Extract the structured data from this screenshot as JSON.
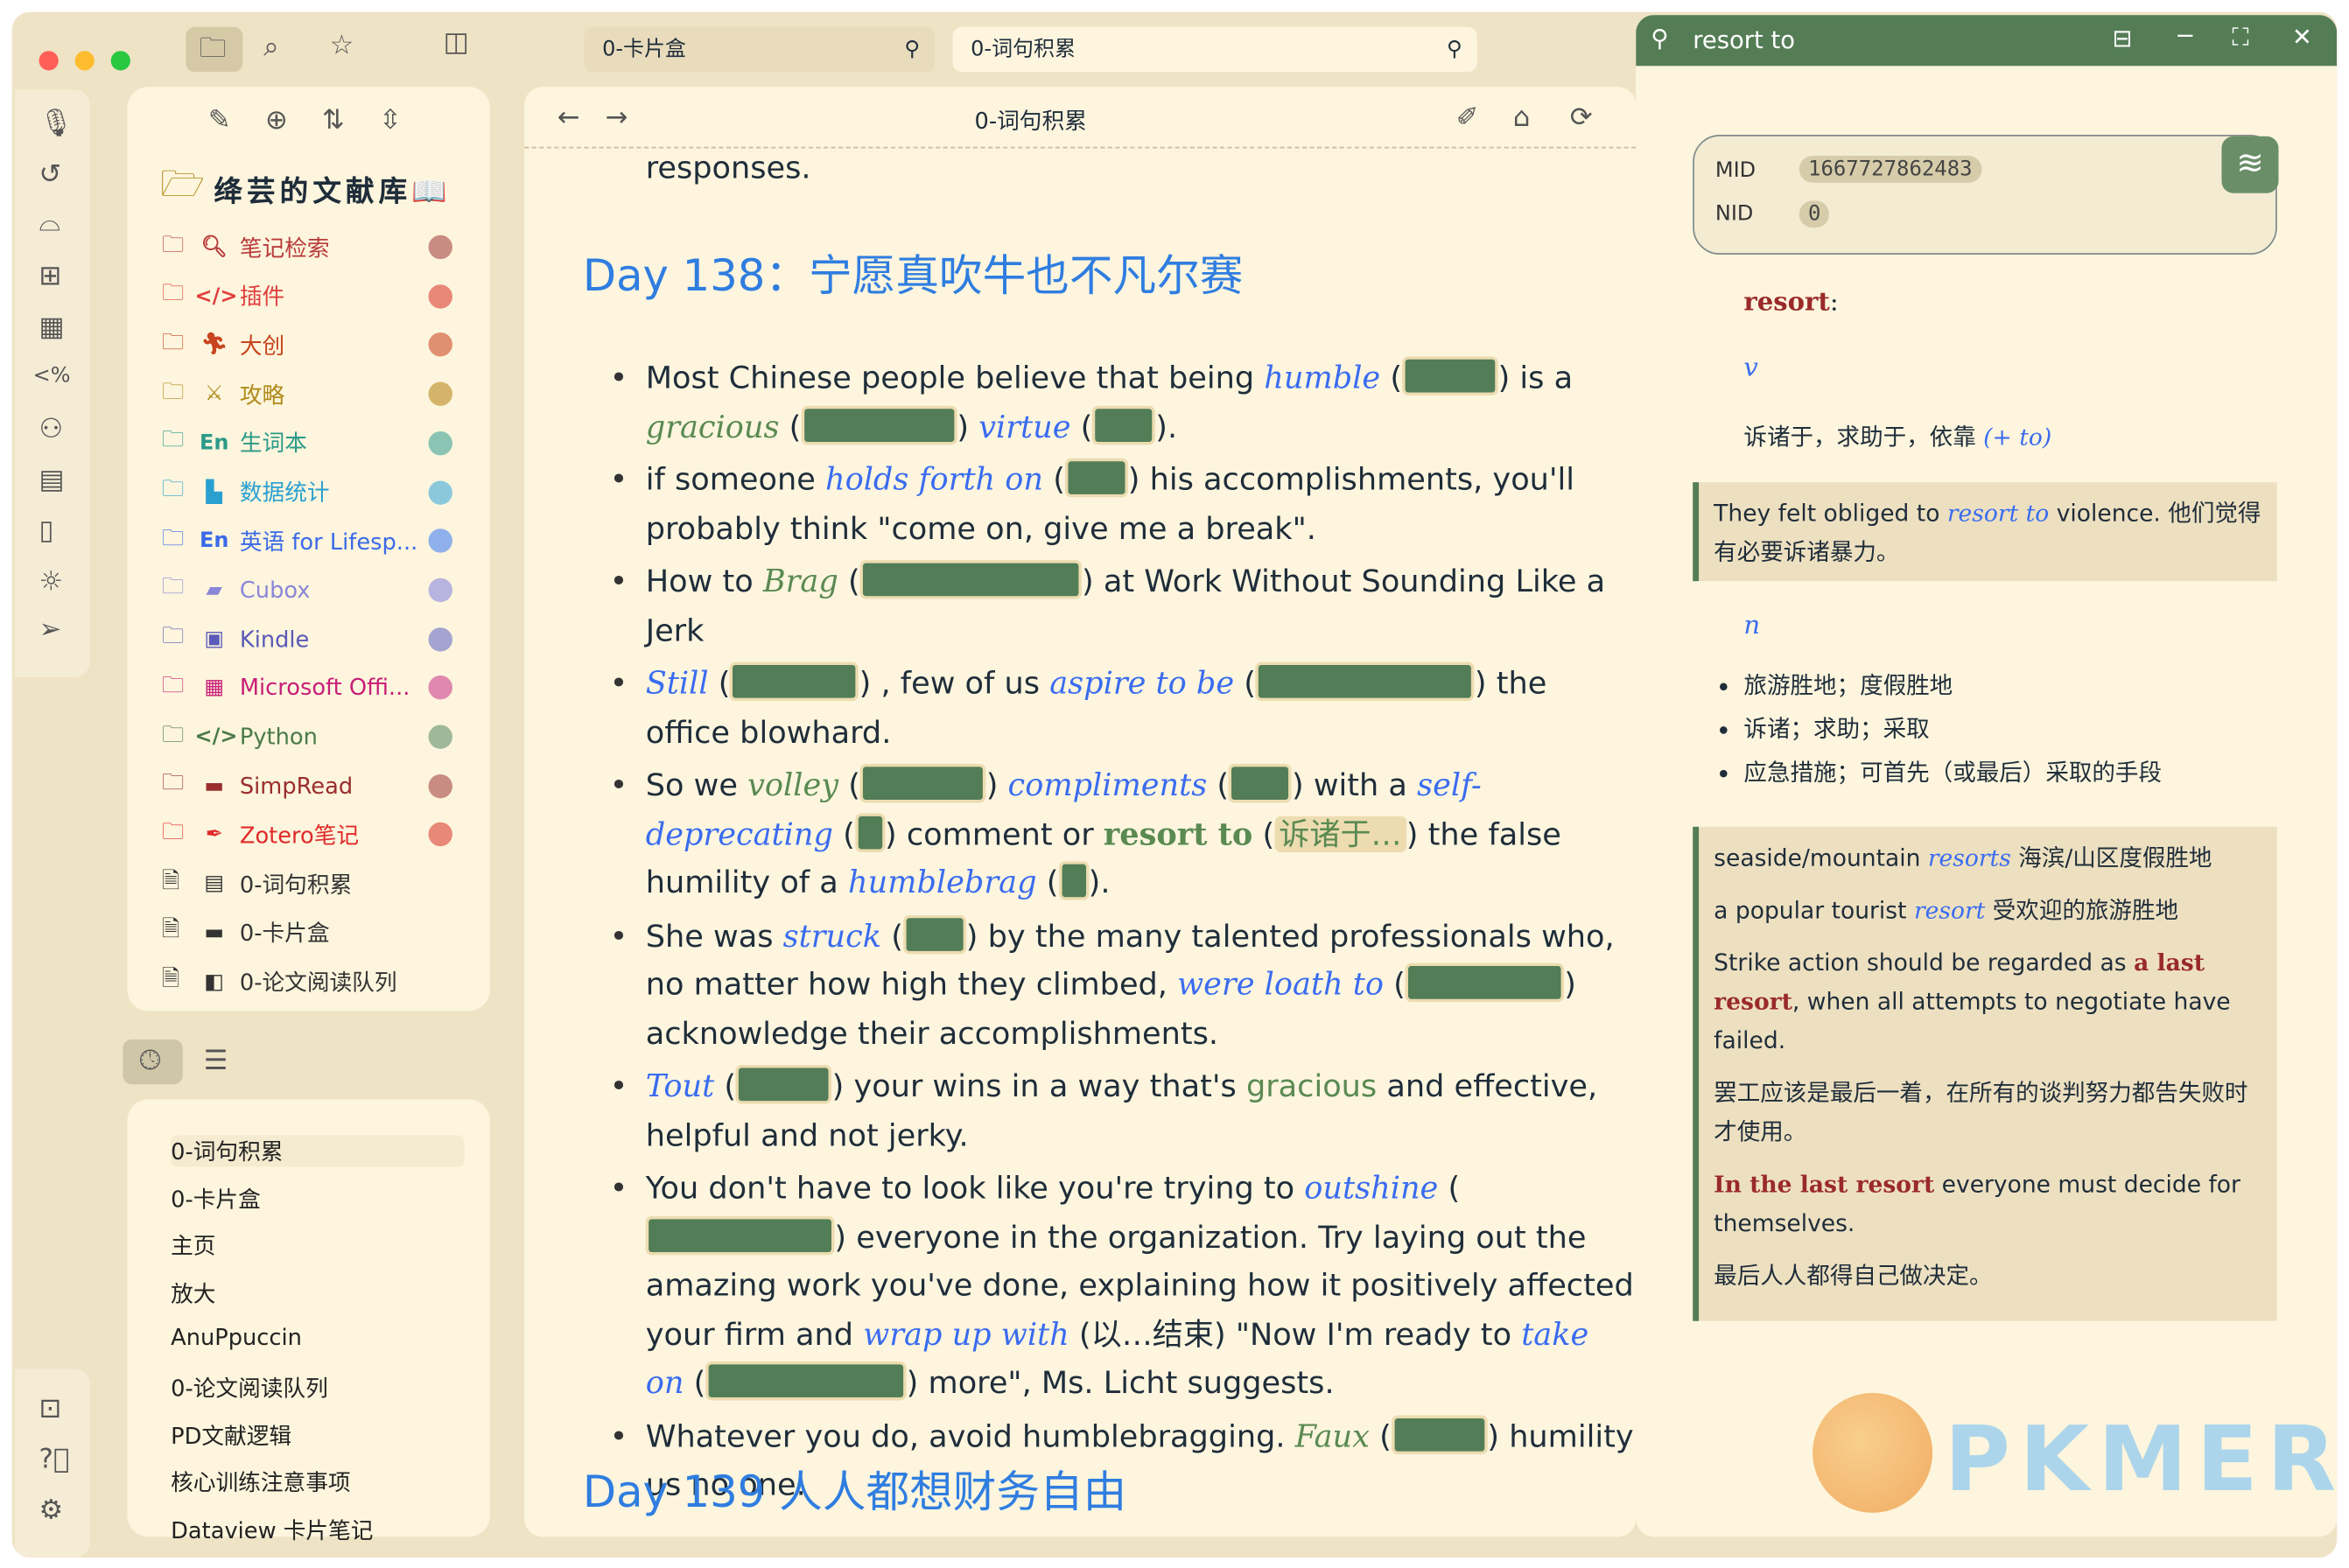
{
  "window": {
    "traffic_colors": [
      "#ff5f57",
      "#febc2e",
      "#28c840"
    ]
  },
  "tabs": [
    {
      "label": "0-卡片盒",
      "active": false
    },
    {
      "label": "0-词句积累",
      "active": true
    }
  ],
  "vault": {
    "title": "绛芸的文献库📖"
  },
  "sidebar": {
    "items": [
      {
        "icon": "search-icon",
        "glyph": "🔍︎",
        "label": "笔记检索",
        "color": "#b83a3a",
        "dot": "#c98c82"
      },
      {
        "icon": "code-icon",
        "glyph": "</>",
        "label": "插件",
        "color": "#e04040",
        "dot": "#e98878"
      },
      {
        "icon": "runner-icon",
        "glyph": "🏃︎",
        "label": "大创",
        "color": "#c8451f",
        "dot": "#e09070"
      },
      {
        "icon": "swords-icon",
        "glyph": "⚔",
        "label": "攻略",
        "color": "#b08a1a",
        "dot": "#d4b46a"
      },
      {
        "icon": "en-icon",
        "glyph": "En",
        "label": "生词本",
        "color": "#2a9a88",
        "dot": "#8cc4b4"
      },
      {
        "icon": "bar-chart-icon",
        "glyph": "▙",
        "label": "数据统计",
        "color": "#2aa0d0",
        "dot": "#8cc8dc"
      },
      {
        "icon": "en-icon",
        "glyph": "En",
        "label": "英语 for Lifesp...",
        "color": "#3a6ae8",
        "dot": "#90b0ec"
      },
      {
        "icon": "box-icon",
        "glyph": "▰",
        "label": "Cubox",
        "color": "#8a86d8",
        "dot": "#b8b4e0"
      },
      {
        "icon": "book-icon",
        "glyph": "▣",
        "label": "Kindle",
        "color": "#5a5ab8",
        "dot": "#a4a4d0"
      },
      {
        "icon": "windows-icon",
        "glyph": "▦",
        "label": "Microsoft Offi...",
        "color": "#c81e78",
        "dot": "#e088b0"
      },
      {
        "icon": "code-icon",
        "glyph": "</>",
        "label": "Python",
        "color": "#4a7a4a",
        "dot": "#a0b89a"
      },
      {
        "icon": "archive-icon",
        "glyph": "▬",
        "label": "SimpRead",
        "color": "#9a2e2e",
        "dot": "#c98c82"
      },
      {
        "icon": "pen-icon",
        "glyph": "✒",
        "label": "Zotero笔记",
        "color": "#e02a2a",
        "dot": "#e88878"
      }
    ],
    "files": [
      {
        "glyph": "▤",
        "label": "0-词句积累"
      },
      {
        "glyph": "▬",
        "label": "0-卡片盒"
      },
      {
        "glyph": "◧",
        "label": "0-论文阅读队列"
      }
    ]
  },
  "recent": {
    "items": [
      "0-词句积累",
      "0-卡片盒",
      "主页",
      "放大",
      "AnuPpuccin",
      "0-论文阅读队列",
      "PD文献逻辑",
      "核心训练注意事项",
      "Dataview 卡片笔记"
    ]
  },
  "main": {
    "title": "0-词句积累",
    "top_text": "responses.",
    "heading1": "Day 138：宁愿真吹牛也不凡尔赛",
    "heading2": "Day 139 人人都想财务自由",
    "bullets": [
      {
        "segs": [
          {
            "t": "Most Chinese people believe that being ",
            "s": "n"
          },
          {
            "t": "humble",
            "s": "b"
          },
          {
            "t": " (",
            "s": "n"
          },
          {
            "t": "",
            "s": "m"
          },
          {
            "t": ") is a ",
            "s": "n"
          },
          {
            "t": "gracious",
            "s": "g"
          },
          {
            "t": " (",
            "s": "n"
          },
          {
            "t": "",
            "s": "m"
          },
          {
            "t": ") ",
            "s": "n"
          },
          {
            "t": "virtue",
            "s": "b"
          },
          {
            "t": " (",
            "s": "n"
          },
          {
            "t": "",
            "s": "m"
          },
          {
            "t": ").",
            "s": "n"
          }
        ]
      },
      {
        "segs": [
          {
            "t": "if someone ",
            "s": "n"
          },
          {
            "t": "holds forth on",
            "s": "b"
          },
          {
            "t": " (",
            "s": "n"
          },
          {
            "t": "",
            "s": "m"
          },
          {
            "t": ") his accomplishments, you'll probably think \"come on, give me a break\".",
            "s": "n"
          }
        ]
      },
      {
        "segs": [
          {
            "t": "How to ",
            "s": "n"
          },
          {
            "t": "Brag",
            "s": "g"
          },
          {
            "t": " (",
            "s": "n"
          },
          {
            "t": "",
            "s": "m"
          },
          {
            "t": ") at Work Without Sounding Like a Jerk",
            "s": "n"
          }
        ]
      },
      {
        "segs": [
          {
            "t": "Still",
            "s": "b"
          },
          {
            "t": " (",
            "s": "n"
          },
          {
            "t": "",
            "s": "m"
          },
          {
            "t": ") , few of us ",
            "s": "n"
          },
          {
            "t": "aspire to be",
            "s": "b"
          },
          {
            "t": "  (",
            "s": "n"
          },
          {
            "t": "",
            "s": "m"
          },
          {
            "t": ")   the office blowhard.",
            "s": "n"
          }
        ]
      },
      {
        "segs": [
          {
            "t": "So we ",
            "s": "n"
          },
          {
            "t": "volley",
            "s": "g"
          },
          {
            "t": " (",
            "s": "n"
          },
          {
            "t": "",
            "s": "m"
          },
          {
            "t": ") ",
            "s": "n"
          },
          {
            "t": "compliments",
            "s": "b"
          },
          {
            "t": " (",
            "s": "n"
          },
          {
            "t": "",
            "s": "m"
          },
          {
            "t": ") with a ",
            "s": "n"
          },
          {
            "t": "self-deprecating",
            "s": "b"
          },
          {
            "t": " (",
            "s": "n"
          },
          {
            "t": "",
            "s": "m"
          },
          {
            "t": ") comment or ",
            "s": "n"
          },
          {
            "t": "resort to",
            "s": "r"
          },
          {
            "t": " (",
            "s": "n"
          },
          {
            "t": "诉诸于…",
            "s": "h"
          },
          {
            "t": ") the false humility of a ",
            "s": "n"
          },
          {
            "t": "humblebrag",
            "s": "b"
          },
          {
            "t": " (",
            "s": "n"
          },
          {
            "t": "",
            "s": "m"
          },
          {
            "t": ").",
            "s": "n"
          }
        ]
      },
      {
        "segs": [
          {
            "t": "She was ",
            "s": "n"
          },
          {
            "t": "struck",
            "s": "b"
          },
          {
            "t": " (",
            "s": "n"
          },
          {
            "t": "",
            "s": "m"
          },
          {
            "t": ") by the many talented professionals who, no matter how high they climbed, ",
            "s": "n"
          },
          {
            "t": "were loath to",
            "s": "b"
          },
          {
            "t": " (",
            "s": "n"
          },
          {
            "t": "",
            "s": "m"
          },
          {
            "t": ") acknowledge their accomplishments.",
            "s": "n"
          }
        ]
      },
      {
        "segs": [
          {
            "t": "Tout",
            "s": "b"
          },
          {
            "t": " (",
            "s": "n"
          },
          {
            "t": "",
            "s": "m"
          },
          {
            "t": ") your wins in a way that's ",
            "s": "n"
          },
          {
            "t": "gracious",
            "s": "gn"
          },
          {
            "t": " and effective, helpful and not jerky.",
            "s": "n"
          }
        ]
      },
      {
        "segs": [
          {
            "t": "You don't have to look like you're trying to ",
            "s": "n"
          },
          {
            "t": "outshine",
            "s": "b"
          },
          {
            "t": " (",
            "s": "n"
          },
          {
            "t": "",
            "s": "m"
          },
          {
            "t": ") everyone in the organization. Try laying out the amazing work you've done, explaining how it positively affected your firm and ",
            "s": "n"
          },
          {
            "t": "wrap up with",
            "s": "b"
          },
          {
            "t": " (以…结束) \"Now I'm ready to ",
            "s": "n"
          },
          {
            "t": "take on",
            "s": "b"
          },
          {
            "t": " (",
            "s": "n"
          },
          {
            "t": "",
            "s": "m"
          },
          {
            "t": ") more\", Ms. Licht suggests.",
            "s": "n"
          }
        ]
      },
      {
        "segs": [
          {
            "t": "Whatever you do, avoid humblebragging. ",
            "s": "n"
          },
          {
            "t": "Faux",
            "s": "g"
          },
          {
            "t": " (",
            "s": "n"
          },
          {
            "t": "",
            "s": "m"
          },
          {
            "t": ") humility us no one.",
            "s": "n"
          }
        ]
      }
    ]
  },
  "popup": {
    "title": "resort to",
    "mid_label": "MID",
    "mid": "1667727862483",
    "nid_label": "NID",
    "nid": "0",
    "word": "resort",
    "colon": ":",
    "pos_v": "v",
    "def_v": "诉诸于，求助于，依靠 ",
    "def_v_note": "(+ to)",
    "ex_v": {
      "a": "They felt obliged to ",
      "k": "resort to",
      "b": " violence. 他们觉得有必要诉诸暴力。"
    },
    "pos_n": "n",
    "defs_n": [
      "旅游胜地；度假胜地",
      "诉诸；求助；采取",
      "应急措施；可首先（或最后）采取的手段"
    ],
    "ex_n": [
      {
        "a": "seaside/mountain ",
        "k": "resorts",
        "b": " 海滨/山区度假胜地",
        "ks": "b"
      },
      {
        "a": "a popular tourist ",
        "k": "resort",
        "b": " 受欢迎的旅游胜地",
        "ks": "b"
      },
      {
        "a": "Strike action should be regarded as ",
        "k": "a last resort",
        "b": ", when all attempts to negotiate have failed.",
        "ks": "r"
      },
      {
        "a": "罢工应该是最后一着，在所有的谈判努力都告失败时才使用。",
        "k": "",
        "b": "",
        "ks": "b"
      },
      {
        "a": "",
        "k": "In the last resort",
        "b": " everyone must decide for themselves.",
        "ks": "r"
      },
      {
        "a": "最后人人都得自己做决定。",
        "k": "",
        "b": "",
        "ks": "b"
      }
    ]
  },
  "watermark": "PKMER"
}
